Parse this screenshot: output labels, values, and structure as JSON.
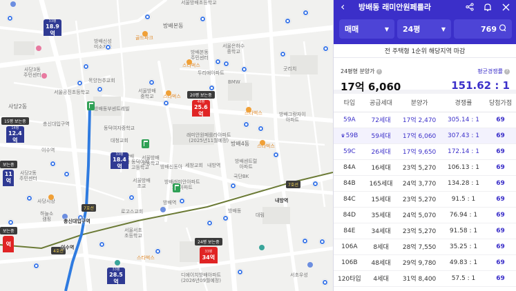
{
  "map": {
    "labels": [
      {
        "id": "seoul-bangbae-es",
        "text": "서울방배초등학교"
      },
      {
        "id": "bangbae-bondong",
        "text": "방배본동"
      },
      {
        "id": "bangbae-bondong-center",
        "text": "방배본동\n주민센터"
      },
      {
        "id": "seoul-gongjin-es",
        "text": "서울공진초등학교"
      },
      {
        "id": "mokyang-cheonju",
        "text": "목양천주교회"
      },
      {
        "id": "sadang2",
        "text": "사당2동"
      },
      {
        "id": "sadang2-center",
        "text": "사당2동\n주민센터"
      },
      {
        "id": "sadang3-center",
        "text": "사당3동\n주민센터"
      },
      {
        "id": "bangbae-dongbu",
        "text": "방배동부센트레빌"
      },
      {
        "id": "bangbae-shinsung",
        "text": "방배신성\n미소지움"
      },
      {
        "id": "eunhasu-ms",
        "text": "서울은하수\n중학교"
      },
      {
        "id": "seoul-bangbae-ms",
        "text": "서울방배\n중학교"
      },
      {
        "id": "dongbuk-ms",
        "text": "동덕여자중학교"
      },
      {
        "id": "bangbae4",
        "text": "방배4동"
      },
      {
        "id": "bangbae-prugio",
        "text": "방배그랑자이\n아파트"
      },
      {
        "id": "raemian-peurella",
        "text": "래미안방배\n페롤라"
      },
      {
        "id": "raemian-2025",
        "text": "래미안원페를라아파트\n(2025년11월예정)"
      },
      {
        "id": "bangbae-station",
        "text": "방배역"
      },
      {
        "id": "naebang-station",
        "text": "내방역"
      },
      {
        "id": "chongsin-station",
        "text": "총신대입구역"
      },
      {
        "id": "isu-station",
        "text": "이수역"
      },
      {
        "id": "diorbangbae",
        "text": "디에이치방배아파트\n(2026년09월예정)"
      },
      {
        "id": "seoul-seoil-es",
        "text": "서울서초\n초등학교"
      },
      {
        "id": "bangbae-hs",
        "text": "서울방배\n고등학교"
      },
      {
        "id": "mt-hospital",
        "text": "로고스교회"
      },
      {
        "id": "bangbae-sindonga",
        "text": "방배신동아"
      },
      {
        "id": "bangbae-central",
        "text": "방배센트럴\n아파트"
      },
      {
        "id": "kukdan-bk",
        "text": "국단BK"
      },
      {
        "id": "daerim",
        "text": "대림"
      },
      {
        "id": "sechang",
        "text": "세창교회"
      },
      {
        "id": "dongduk-hs",
        "text": "동덕여자\n고등학교"
      },
      {
        "id": "bangbae-bhs",
        "text": "방배동"
      },
      {
        "id": "haneul",
        "text": "하늘소\n캠핑"
      },
      {
        "id": "bangbae-gs",
        "text": "서울방배\n초교"
      },
      {
        "id": "bmw",
        "text": "BMW"
      },
      {
        "id": "dunkin",
        "text": "두리애아파트"
      },
      {
        "id": "gold-park",
        "text": "골드파크"
      },
      {
        "id": "starbucks1",
        "text": "스타벅스"
      },
      {
        "id": "starbucks2",
        "text": "스타벅스"
      },
      {
        "id": "starbucks3",
        "text": "스타벅스"
      },
      {
        "id": "starbucks4",
        "text": "스타벅스"
      },
      {
        "id": "starbucks5",
        "text": "스타벅스"
      },
      {
        "id": "goodrich",
        "text": "굿리치"
      },
      {
        "id": "daechung",
        "text": "대청교회"
      },
      {
        "id": "seochos",
        "text": "서초우성"
      },
      {
        "id": "sadang-market",
        "text": "사당시장"
      },
      {
        "id": "banpo",
        "text": "방배래미안아파트\n1차아파트"
      }
    ],
    "pins": [
      {
        "id": "pin-33-18-9",
        "tag": "",
        "sub": "33평",
        "value": "18.9억",
        "color": "navy"
      },
      {
        "id": "pin-20-25-6",
        "tag": "20평 보는중",
        "sub": "46평",
        "value": "25.6억",
        "color": "red"
      },
      {
        "id": "pin-15-12-4",
        "tag": "15평 보는중",
        "sub": "14평",
        "value": "12.4억",
        "color": "navy"
      },
      {
        "id": "pin-33-18-4",
        "tag": "",
        "sub": "33평",
        "value": "18.4억",
        "color": "navy"
      },
      {
        "id": "pin-left-11",
        "tag": "보는중",
        "sub": "",
        "value": "11억",
        "color": "navy"
      },
      {
        "id": "pin-24-34",
        "tag": "24평 보는중",
        "sub": "33평",
        "value": "34억",
        "color": "red"
      },
      {
        "id": "pin-33-28-5",
        "tag": "",
        "sub": "33평",
        "value": "28.5억",
        "color": "navy"
      },
      {
        "id": "pin-left-red",
        "tag": "보는중",
        "sub": "",
        "value": "억",
        "color": "red"
      }
    ],
    "stations": [
      {
        "id": "st-chongsin",
        "tag": "7호선"
      },
      {
        "id": "st-isu",
        "tag": "4호선"
      },
      {
        "id": "st-naebang",
        "tag": "7호선"
      }
    ]
  },
  "panel": {
    "header": {
      "title": "방배동 래미안원페를라"
    },
    "filters": {
      "deal_type": "매매",
      "size": "24평",
      "people": "769"
    },
    "notice": "전 주택형 1순위 해당지역 마감",
    "summary": {
      "price_label": "24평형 분양가",
      "price_value": "17억 6,060",
      "rate_label": "평균경쟁률",
      "rate_value": "151.62 : 1"
    },
    "table": {
      "headers": [
        "타입",
        "공급세대",
        "분양가",
        "경쟁률",
        "당첨가점"
      ],
      "rows": [
        {
          "type": "59A",
          "units": "72세대",
          "price": "17억 2,470",
          "rate": "305.14 : 1",
          "score": "69",
          "hl": true,
          "sel": false
        },
        {
          "type": "59B",
          "units": "59세대",
          "price": "17억 6,060",
          "rate": "307.43 : 1",
          "score": "69",
          "hl": true,
          "sel": true,
          "crown": "♛"
        },
        {
          "type": "59C",
          "units": "26세대",
          "price": "17억 9,650",
          "rate": "172.14 : 1",
          "score": "69",
          "hl": true,
          "sel": false
        },
        {
          "type": "84A",
          "units": "16세대",
          "price": "23억 5,270",
          "rate": "106.13 : 1",
          "score": "69",
          "hl": false,
          "sel": false
        },
        {
          "type": "84B",
          "units": "165세대",
          "price": "24억 3,770",
          "rate": "134.28 : 1",
          "score": "69",
          "hl": false,
          "sel": false
        },
        {
          "type": "84C",
          "units": "15세대",
          "price": "23억 5,270",
          "rate": "91.5 : 1",
          "score": "69",
          "hl": false,
          "sel": false
        },
        {
          "type": "84D",
          "units": "35세대",
          "price": "24억 5,070",
          "rate": "76.94 : 1",
          "score": "69",
          "hl": false,
          "sel": false
        },
        {
          "type": "84E",
          "units": "34세대",
          "price": "23억 5,270",
          "rate": "91.58 : 1",
          "score": "69",
          "hl": false,
          "sel": false
        },
        {
          "type": "106A",
          "units": "8세대",
          "price": "28억 7,550",
          "rate": "35.25 : 1",
          "score": "69",
          "hl": false,
          "sel": false
        },
        {
          "type": "106B",
          "units": "48세대",
          "price": "29억 9,780",
          "rate": "49.83 : 1",
          "score": "69",
          "hl": false,
          "sel": false
        },
        {
          "type": "120타입",
          "units": "4세대",
          "price": "31억 8,400",
          "rate": "57.5 : 1",
          "score": "69",
          "hl": false,
          "sel": false
        }
      ]
    },
    "colors": {
      "brand": "#3b2fc9",
      "pin_red": "#e02424",
      "pin_navy": "#2f3a93",
      "bus": "#3d78e6",
      "subway_line": "#6b7a35"
    }
  }
}
